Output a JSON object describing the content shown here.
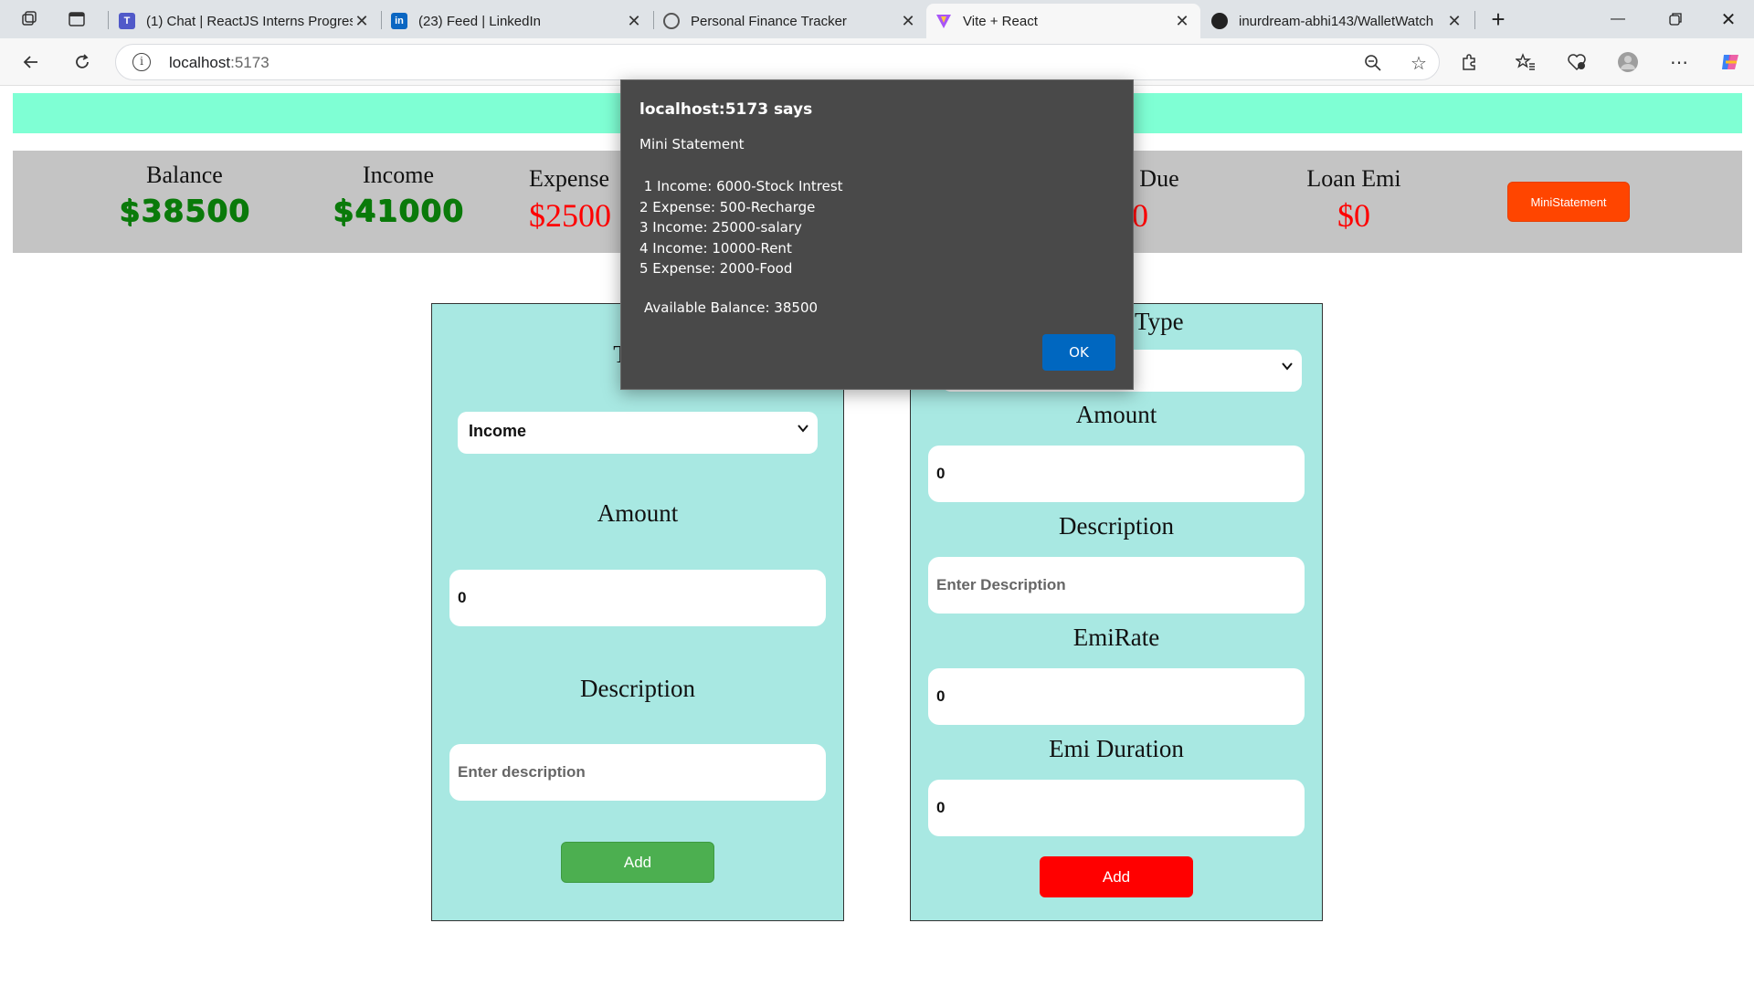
{
  "browser": {
    "tabs": [
      {
        "title": "(1) Chat | ReactJS Interns Progress",
        "favicon": "teams-icon",
        "color": "#5059c9"
      },
      {
        "title": "(23) Feed | LinkedIn",
        "favicon": "linkedin-icon",
        "color": "#0a66c2"
      },
      {
        "title": "Personal Finance Tracker",
        "favicon": "globe-icon",
        "color": "#555555"
      },
      {
        "title": "Vite + React",
        "favicon": "vite-icon",
        "color": "#a855f7"
      },
      {
        "title": "inurdream-abhi143/WalletWatch",
        "favicon": "github-icon",
        "color": "#222222"
      }
    ],
    "address": {
      "host": "localhost",
      "port": ":5173"
    }
  },
  "summary": {
    "balance_label": "Balance",
    "balance_value": "$38500",
    "income_label": "Income",
    "income_value": "$41000",
    "expense_label": "Expense",
    "expense_value": "$2500",
    "loan_due_label": "Loan Due",
    "loan_due_value": "$0",
    "loan_emi_label": "Loan Emi",
    "loan_emi_value": "$0",
    "mini_statement_button": "MiniStatement"
  },
  "transaction_form": {
    "type_heading": "Type",
    "type_selected": "Income",
    "amount_heading": "Amount",
    "amount_value": "0",
    "description_heading": "Description",
    "description_placeholder": "Enter description",
    "add_button": "Add"
  },
  "loan_form": {
    "type_heading": "Type",
    "amount_heading": "Amount",
    "amount_value": "0",
    "description_heading": "Description",
    "description_placeholder": "Enter Description",
    "emi_rate_heading": "EmiRate",
    "emi_rate_value": "0",
    "emi_duration_heading": "Emi Duration",
    "emi_duration_value": "0",
    "add_button": "Add"
  },
  "dialog": {
    "title": "localhost:5173 says",
    "heading": "Mini Statement",
    "lines": [
      " 1 Income: 6000-Stock Intrest",
      "2 Expense: 500-Recharge",
      "3 Income: 25000-salary",
      "4 Income: 10000-Rent",
      "5 Expense: 2000-Food"
    ],
    "balance_line": "Available Balance: 38500",
    "ok_button": "OK"
  },
  "colors": {
    "top_band": "#7fffd4",
    "summary_bg": "#c4c4c4",
    "card_bg": "#a8e8e2",
    "positive": "#0a7a0a",
    "negative": "#ff0000",
    "mini_button": "#ff4500",
    "add_income_button": "#4caf50",
    "add_loan_button": "#ff0000",
    "dialog_bg": "#494949",
    "ok_button": "#0067c0"
  }
}
